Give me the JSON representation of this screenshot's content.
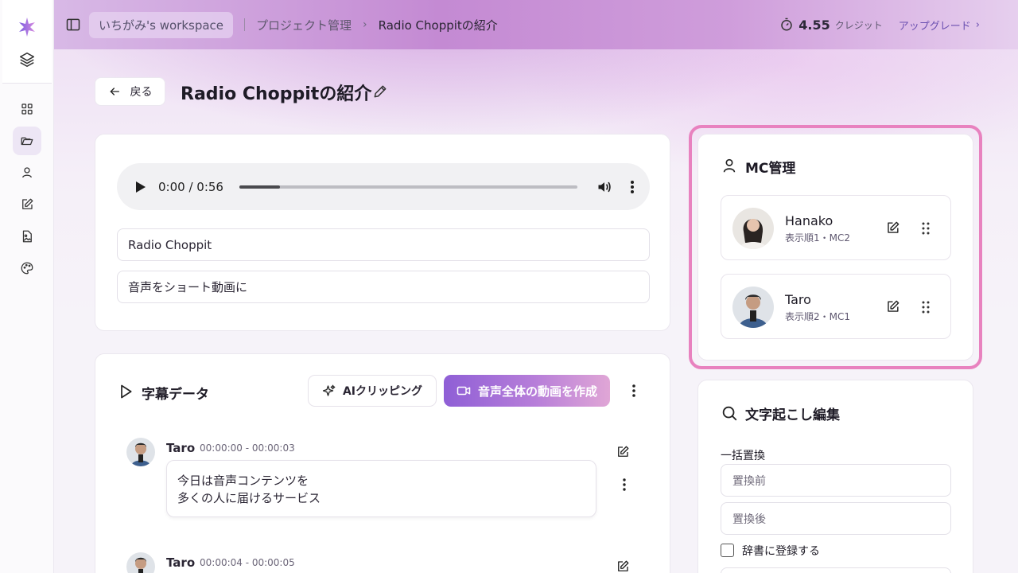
{
  "header": {
    "workspace": "いちがみ's workspace",
    "breadcrumb_parent": "プロジェクト管理",
    "breadcrumb_current": "Radio Choppitの紹介",
    "credits_value": "4.55",
    "credits_label": "クレジット",
    "upgrade_label": "アップグレード"
  },
  "page": {
    "back_label": "戻る",
    "title": "Radio Choppitの紹介"
  },
  "audio": {
    "time": "0:00 / 0:56",
    "progress": 0.12,
    "field1": "Radio Choppit",
    "field2": "音声をショート動画に"
  },
  "subtitles": {
    "title": "字幕データ",
    "ai_button": "AIクリッピング",
    "create_button": "音声全体の動画を作成",
    "segments": [
      {
        "speaker": "Taro",
        "time": "00:00:00 - 00:00:03",
        "line1": "今日は音声コンテンツを",
        "line2": "多くの人に届けるサービス"
      },
      {
        "speaker": "Taro",
        "time": "00:00:04 - 00:00:05"
      }
    ]
  },
  "mc": {
    "title": "MC管理",
    "items": [
      {
        "name": "Hanako",
        "detail": "表示順1・MC2"
      },
      {
        "name": "Taro",
        "detail": "表示順2・MC1"
      }
    ]
  },
  "transcript": {
    "title": "文字起こし編集",
    "bulk_label": "一括置換",
    "before_placeholder": "置換前",
    "after_placeholder": "置換後",
    "dict_label": "辞書に登録する"
  },
  "colors": {
    "accent": "#8f5fd6",
    "highlight": "#e882bf"
  }
}
